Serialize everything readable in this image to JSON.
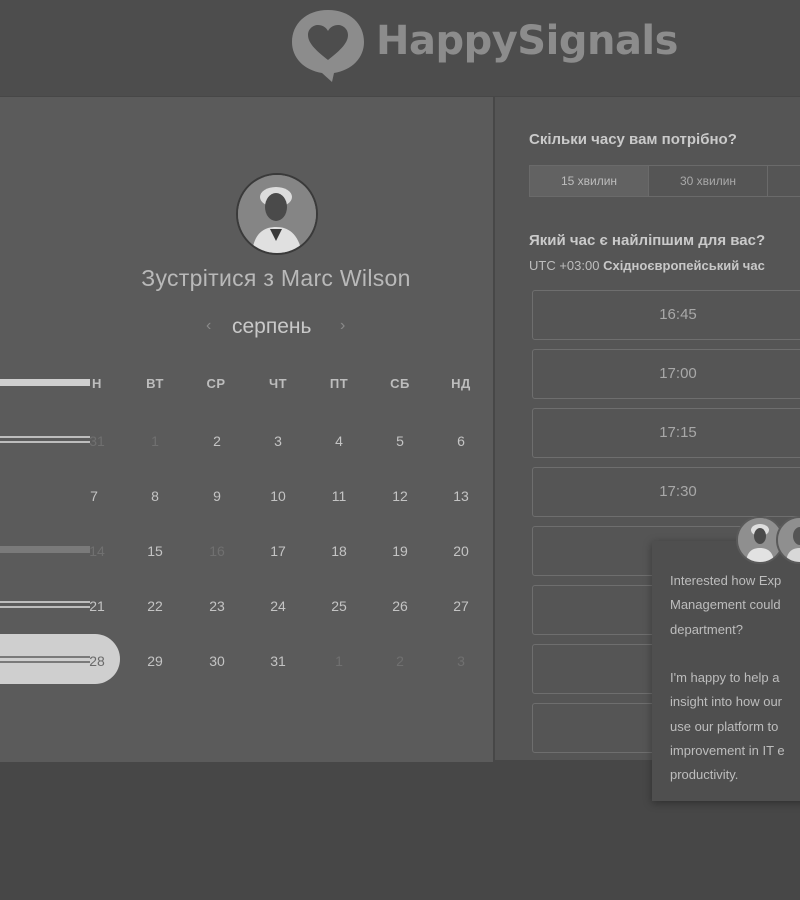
{
  "brand": {
    "logo_text": "HappySignals"
  },
  "scheduler": {
    "meeting_title": "Зустрітися з Marc Wilson",
    "month": "серпень",
    "prev_arrow": "‹",
    "next_arrow": "›",
    "weekdays": [
      "Н",
      "ВТ",
      "СР",
      "ЧТ",
      "ПТ",
      "СБ",
      "НД"
    ],
    "weeks": [
      [
        "31",
        "1",
        "2",
        "3",
        "4",
        "5",
        "6"
      ],
      [
        "7",
        "8",
        "9",
        "10",
        "11",
        "12",
        "13"
      ],
      [
        "14",
        "15",
        "16",
        "17",
        "18",
        "19",
        "20"
      ],
      [
        "21",
        "22",
        "23",
        "24",
        "25",
        "26",
        "27"
      ],
      [
        "28",
        "29",
        "30",
        "31",
        "1",
        "2",
        "3"
      ]
    ]
  },
  "booking": {
    "duration_question": "Скільки часу вам потрібно?",
    "durations": [
      "15 хвилин",
      "30 хвилин",
      ""
    ],
    "time_question": "Який час є найліпшим для вас?",
    "timezone_prefix": "UTC +03:00",
    "timezone_name": "Східноєвропейський час",
    "slots": [
      "16:45",
      "17:00",
      "17:15",
      "17:30",
      "",
      "",
      ""
    ]
  },
  "chat": {
    "message": "Interested how Exp\nManagement could\ndepartment?\n\nI'm happy to help a\ninsight into how our\nuse our platform to\nimprovement in IT e\nproductivity."
  }
}
